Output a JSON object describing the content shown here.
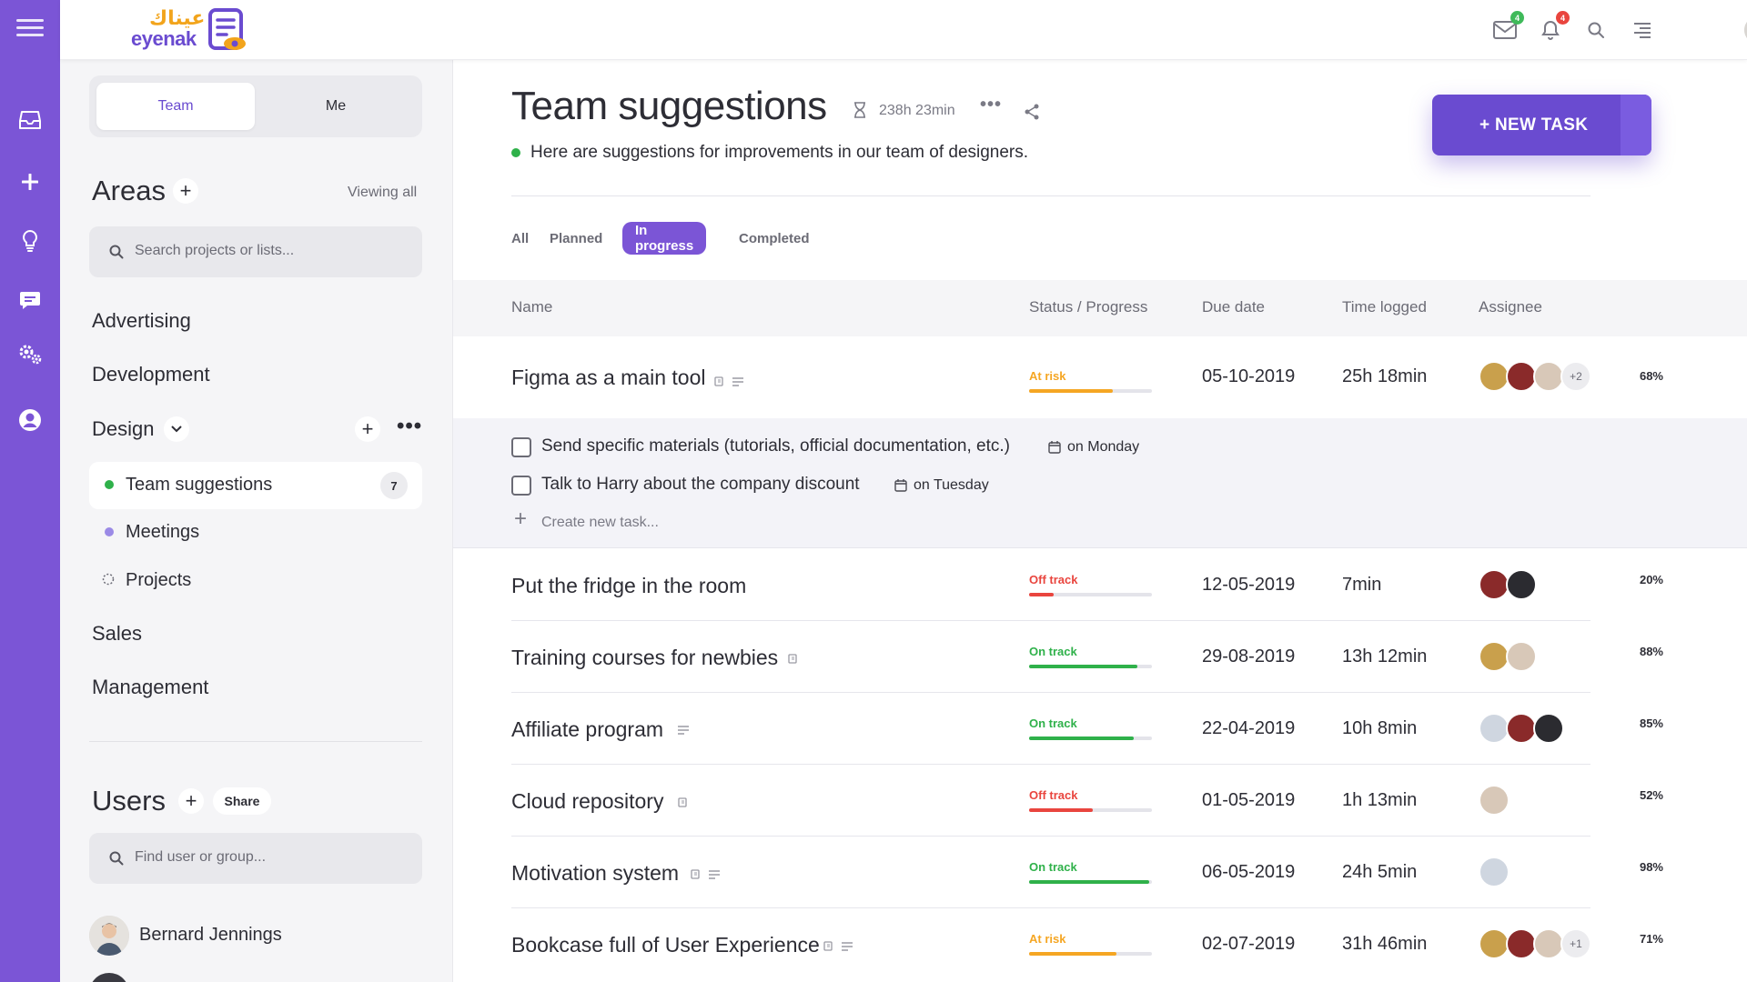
{
  "app": {
    "logo_ar": "عيناك",
    "logo_en": "eyenak",
    "mail_badge": "4",
    "bell_badge": "4"
  },
  "rail_icons": [
    "menu-icon",
    "inbox-icon",
    "plus-icon",
    "lightbulb-icon",
    "chat-icon",
    "settings-icon",
    "user-icon"
  ],
  "sidebar": {
    "segment": {
      "active": "Team",
      "inactive": "Me"
    },
    "areas_title": "Areas",
    "viewing_label": "Viewing all",
    "search_placeholder": "Search projects or lists...",
    "areas": [
      {
        "label": "Advertising"
      },
      {
        "label": "Development"
      },
      {
        "label": "Design"
      },
      {
        "label": "Sales"
      },
      {
        "label": "Management"
      }
    ],
    "design_children": [
      {
        "label": "Team suggestions",
        "count": "7",
        "dot_color": "#2fb14a"
      },
      {
        "label": "Meetings",
        "dot_color": "#9b8ae6"
      },
      {
        "label": "Projects"
      }
    ],
    "users_title": "Users",
    "users_share": "Share",
    "user_search_placeholder": "Find user or group...",
    "users": [
      {
        "name": "Bernard Jennings"
      }
    ]
  },
  "main": {
    "title": "Team suggestions",
    "time": "238h 23min",
    "description": "Here are suggestions for improvements in our team of designers.",
    "new_task_label": "+ NEW TASK",
    "filters": [
      "All",
      "Planned",
      "In progress",
      "Completed"
    ],
    "active_filter": "In progress",
    "columns": [
      "Name",
      "Status / Progress",
      "Due date",
      "Time logged",
      "Assignee"
    ],
    "rows": [
      {
        "name": "Figma as a main tool",
        "status": "At risk",
        "progress": 68,
        "progress_label": "68%",
        "due": "05-10-2019",
        "logged": "25h 18min",
        "more": "+2"
      },
      {
        "name": "Put the fridge in the room",
        "status": "Off track",
        "progress": 20,
        "progress_label": "20%",
        "due": "12-05-2019",
        "logged": "7min"
      },
      {
        "name": "Training courses for newbies",
        "status": "On track",
        "progress": 88,
        "progress_label": "88%",
        "due": "29-08-2019",
        "logged": "13h 12min"
      },
      {
        "name": "Affiliate program",
        "status": "On track",
        "progress": 85,
        "progress_label": "85%",
        "due": "22-04-2019",
        "logged": "10h 8min"
      },
      {
        "name": "Cloud repository",
        "status": "Off track",
        "progress": 52,
        "progress_label": "52%",
        "due": "01-05-2019",
        "logged": "1h 13min"
      },
      {
        "name": "Motivation system",
        "status": "On track",
        "progress": 98,
        "progress_label": "98%",
        "due": "06-05-2019",
        "logged": "24h 5min"
      },
      {
        "name": "Bookcase full of User Experience",
        "status": "At risk",
        "progress": 71,
        "progress_label": "71%",
        "due": "02-07-2019",
        "logged": "31h 46min",
        "more": "+1"
      }
    ],
    "subtasks": [
      {
        "label": "Send specific materials (tutorials, official documentation, etc.)",
        "when": "on Monday"
      },
      {
        "label": "Talk to Harry about the company discount",
        "when": "on Tuesday"
      }
    ],
    "create_task_placeholder": "Create new task..."
  },
  "colors": {
    "brand": "#7b55d6",
    "at_risk": "#f5a623",
    "off_track": "#e9453e",
    "on_track": "#2fb14a"
  }
}
